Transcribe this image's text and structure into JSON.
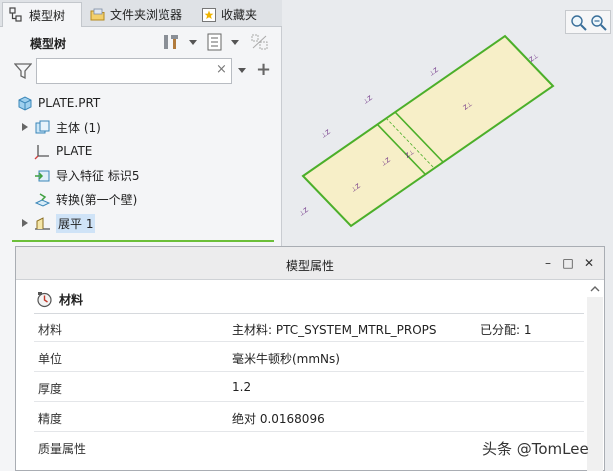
{
  "tabs": [
    {
      "label": "模型树",
      "active": true
    },
    {
      "label": "文件夹浏览器",
      "active": false
    },
    {
      "label": "收藏夹",
      "active": false
    }
  ],
  "tree_header": {
    "title": "模型树"
  },
  "search": {
    "value": "",
    "placeholder": "",
    "clear_symbol": "×"
  },
  "add_symbol": "+",
  "tree": [
    {
      "label": "PLATE.PRT",
      "icon": "part-icon",
      "expandable": false,
      "selected": false
    },
    {
      "label": "主体 (1)",
      "icon": "body-icon",
      "expandable": true,
      "selected": false
    },
    {
      "label": "PLATE",
      "icon": "csys-icon",
      "expandable": false,
      "selected": false
    },
    {
      "label": "导入特征 标识5",
      "icon": "import-feature-icon",
      "expandable": false,
      "selected": false
    },
    {
      "label": "转换(第一个壁)",
      "icon": "convert-wall-icon",
      "expandable": false,
      "selected": false
    },
    {
      "label": "展平 1",
      "icon": "flatten-icon",
      "expandable": true,
      "selected": true
    }
  ],
  "dialog": {
    "title": "模型属性",
    "window_buttons": {
      "minimize": "–",
      "maximize": "□",
      "close": "✕"
    },
    "section": {
      "label": "材料",
      "icon": "material-icon"
    },
    "rows": [
      {
        "key": "材料",
        "value": "主材料: PTC_SYSTEM_MTRL_PROPS",
        "extra": "已分配: 1"
      },
      {
        "key": "单位",
        "value": "毫米牛顿秒(mmNs)",
        "extra": ""
      },
      {
        "key": "厚度",
        "value": "1.2",
        "extra": ""
      },
      {
        "key": "精度",
        "value": "绝对 0.0168096",
        "extra": ""
      },
      {
        "key": "质量属性",
        "value": "",
        "extra": ""
      }
    ]
  },
  "watermark": "头条 @TomLee",
  "colors": {
    "plate_fill": "#f7efc8",
    "plate_edge": "#4caf2a",
    "accent_green": "#6cbf3a",
    "selection": "#cfe3f7"
  }
}
